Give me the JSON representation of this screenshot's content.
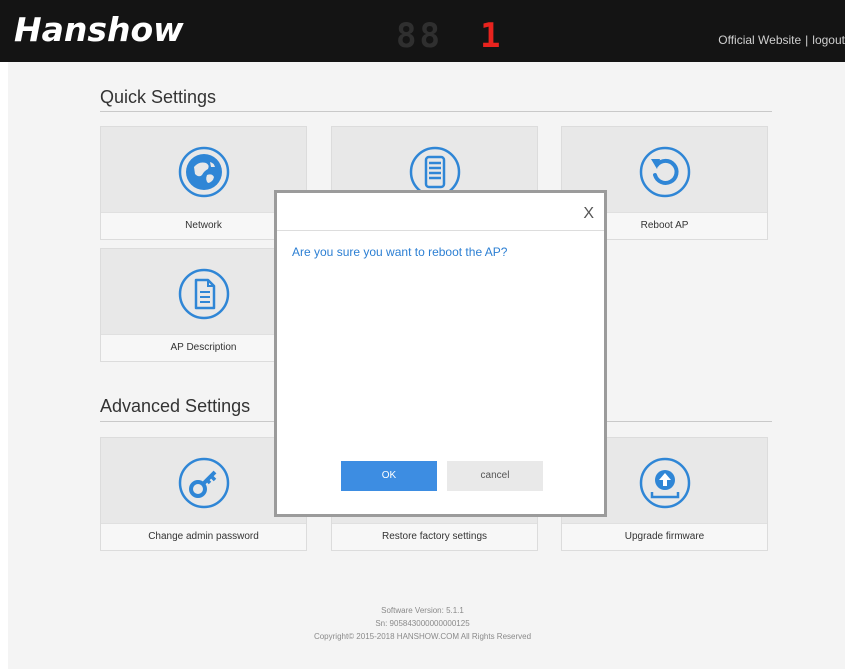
{
  "header": {
    "logo": "Hanshow",
    "display_dim": "88",
    "display_lit": "1",
    "official_website": "Official Website",
    "separator": "|",
    "logout": "logout"
  },
  "quick_settings": {
    "title": "Quick Settings",
    "tiles": [
      {
        "label": "Network",
        "icon": "globe-icon"
      },
      {
        "label": "",
        "icon": "list-icon"
      },
      {
        "label": "Reboot AP",
        "icon": "reboot-icon"
      },
      {
        "label": "AP Description",
        "icon": "document-icon"
      }
    ]
  },
  "advanced_settings": {
    "title": "Advanced Settings",
    "tiles": [
      {
        "label": "Change admin password",
        "icon": "key-icon"
      },
      {
        "label": "Restore factory settings",
        "icon": "restore-icon"
      },
      {
        "label": "Upgrade firmware",
        "icon": "upload-icon"
      }
    ]
  },
  "footer": {
    "software_version": "Software Version: 5.1.1",
    "sn": "Sn: 905843000000000125",
    "copyright": "Copyright© 2015-2018 HANSHOW.COM All Rights Reserved"
  },
  "dialog": {
    "close": "X",
    "message": "Are you sure you want to reboot the AP?",
    "ok": "OK",
    "cancel": "cancel"
  },
  "colors": {
    "header_bg": "#141414",
    "accent": "#3d8de2",
    "icon_blue": "#2f86d6",
    "display_red": "#e8231e"
  }
}
